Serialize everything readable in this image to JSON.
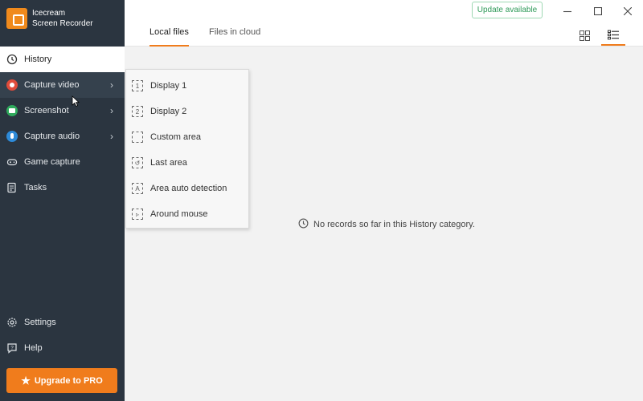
{
  "app": {
    "name_line1": "Icecream",
    "name_line2": "Screen Recorder"
  },
  "sidebar": {
    "items": [
      {
        "label": "History",
        "icon": "clock-icon",
        "active": true
      },
      {
        "label": "Capture video",
        "icon": "record-icon",
        "has_submenu": true
      },
      {
        "label": "Screenshot",
        "icon": "camera-icon",
        "has_submenu": true
      },
      {
        "label": "Capture audio",
        "icon": "microphone-icon",
        "has_submenu": true
      },
      {
        "label": "Game capture",
        "icon": "gamepad-icon"
      },
      {
        "label": "Tasks",
        "icon": "tasks-icon"
      }
    ],
    "bottom_items": [
      {
        "label": "Settings",
        "icon": "gear-icon"
      },
      {
        "label": "Help",
        "icon": "help-icon"
      }
    ],
    "upgrade_label": "Upgrade to PRO"
  },
  "topbar": {
    "update_label": "Update available",
    "tabs": [
      {
        "label": "Local files",
        "active": true
      },
      {
        "label": "Files in cloud",
        "active": false
      }
    ]
  },
  "submenu": {
    "items": [
      {
        "label": "Display 1",
        "glyph": "1"
      },
      {
        "label": "Display 2",
        "glyph": "2"
      },
      {
        "label": "Custom area",
        "glyph": ""
      },
      {
        "label": "Last area",
        "glyph": "↺"
      },
      {
        "label": "Area auto detection",
        "glyph": "A"
      },
      {
        "label": "Around mouse",
        "glyph": "▹"
      }
    ]
  },
  "main": {
    "empty_message": "No records so far in this History category."
  },
  "colors": {
    "sidebar_bg": "#2b3540",
    "accent": "#f07c1c",
    "update_green": "#2e9a58"
  }
}
